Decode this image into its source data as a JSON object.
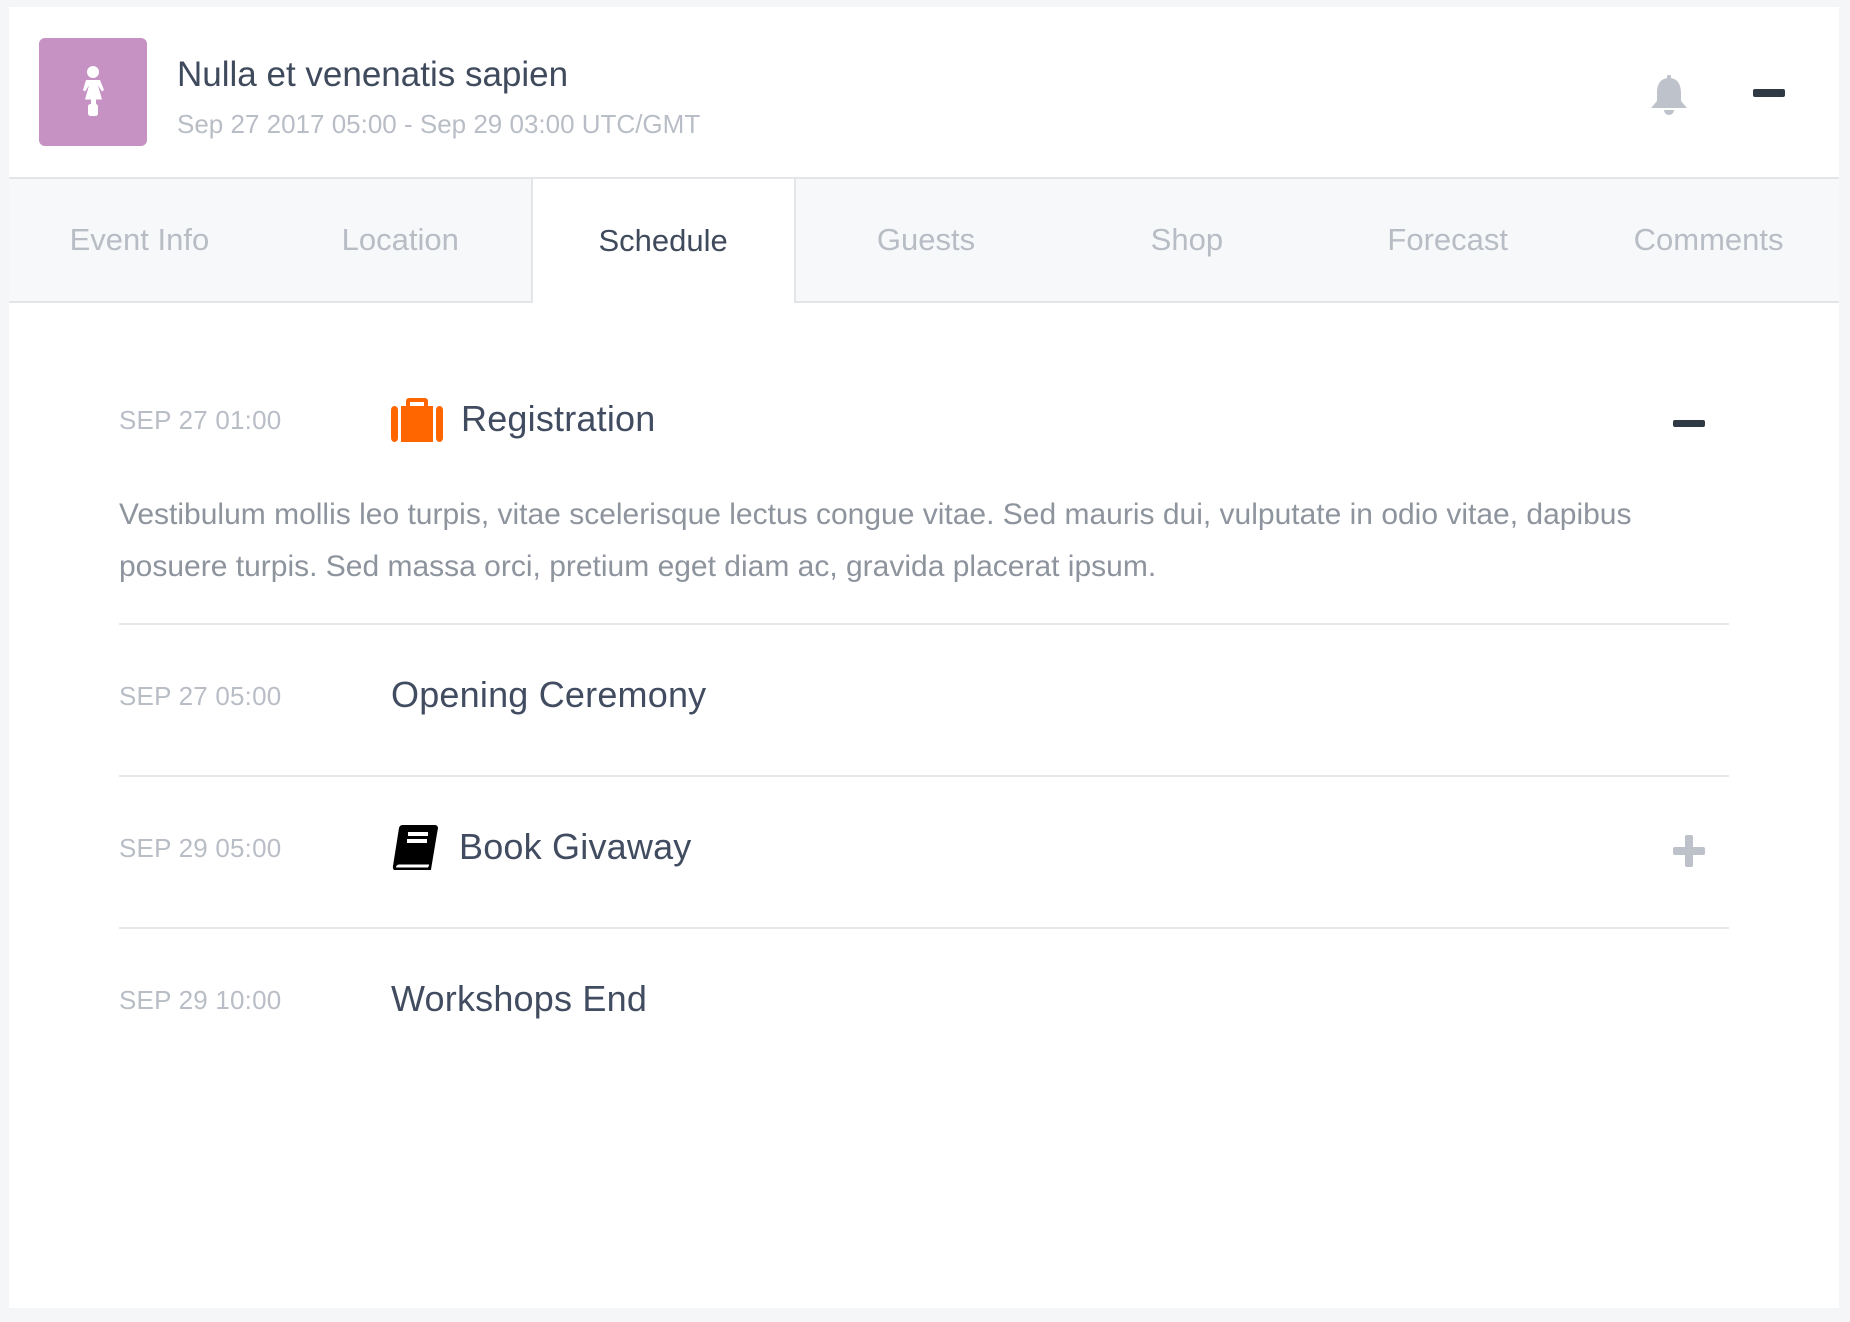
{
  "header": {
    "avatar_icon": "female-icon",
    "avatar_color": "#c592c3",
    "title": "Nulla et venenatis sapien",
    "subtitle": "Sep 27 2017 05:00 - Sep 29 03:00 UTC/GMT",
    "notification_icon": "bell-icon",
    "collapse_icon": "minus-icon"
  },
  "tabs": [
    {
      "label": "Event Info",
      "active": false
    },
    {
      "label": "Location",
      "active": false
    },
    {
      "label": "Schedule",
      "active": true
    },
    {
      "label": "Guests",
      "active": false
    },
    {
      "label": "Shop",
      "active": false
    },
    {
      "label": "Forecast",
      "active": false
    },
    {
      "label": "Comments",
      "active": false
    }
  ],
  "schedule": [
    {
      "time": "SEP 27 01:00",
      "icon": "briefcase-icon",
      "icon_color": "#ff6600",
      "title": "Registration",
      "expanded": true,
      "toggle": "minus-icon",
      "description": "Vestibulum mollis leo turpis, vitae scelerisque lectus congue vitae. Sed mauris dui, vulputate in odio vitae, dapibus posuere turpis. Sed massa orci, pretium eget diam ac, gravida placerat ipsum."
    },
    {
      "time": "SEP 27 05:00",
      "icon": null,
      "title": "Opening Ceremony",
      "expanded": false,
      "toggle": null
    },
    {
      "time": "SEP 29 05:00",
      "icon": "book-icon",
      "icon_color": "#000000",
      "title": "Book Givaway",
      "expanded": false,
      "toggle": "plus-icon"
    },
    {
      "time": "SEP 29 10:00",
      "icon": null,
      "title": "Workshops End",
      "expanded": false,
      "toggle": null
    }
  ]
}
